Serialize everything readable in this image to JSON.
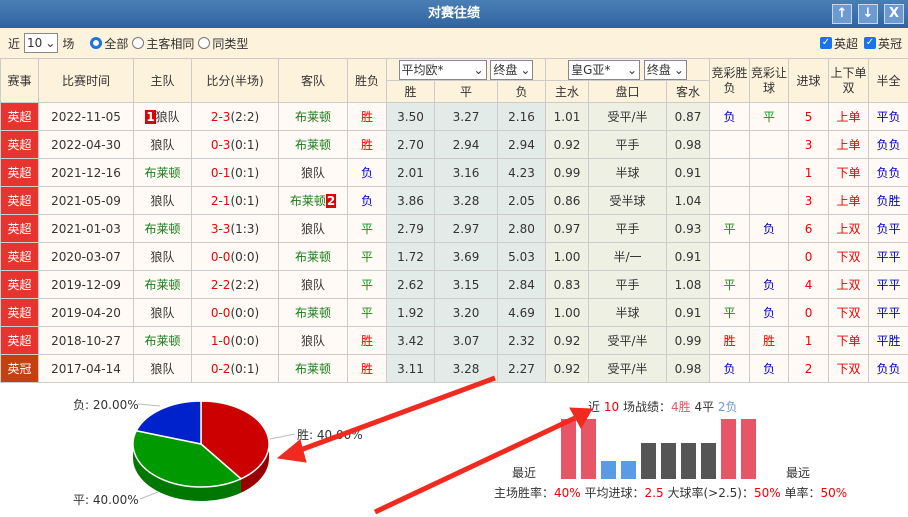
{
  "title": "对赛往绩",
  "title_buttons": [
    "↑",
    "↓",
    "X"
  ],
  "filter": {
    "prefix": "近",
    "count": "10",
    "suffix": "场",
    "radios": [
      "全部",
      "主客相同",
      "同类型"
    ],
    "selected_radio": "全部",
    "leagues": [
      "英超",
      "英冠"
    ]
  },
  "header": {
    "cols": [
      "赛事",
      "比赛时间",
      "主队",
      "比分(半场)",
      "客队",
      "胜负"
    ],
    "euro_select": "平均欧*",
    "euro_type": "终盘",
    "euro_cols": [
      "胜",
      "平",
      "负"
    ],
    "asia_select": "皇G亚*",
    "asia_type": "终盘",
    "asia_cols": [
      "主水",
      "盘口",
      "客水"
    ],
    "jc_result": "竞彩胜负",
    "jc_handicap": "竞彩让球",
    "goals": "进球",
    "ou": "上下单双",
    "htft": "半全"
  },
  "rows": [
    {
      "league": "英超",
      "date": "2022-11-05",
      "home": "狼队",
      "home_rank": "1",
      "score": "2-3",
      "half": "(2:2)",
      "away": "布莱顿",
      "away_rank": "",
      "res": "胜",
      "e": [
        "3.50",
        "3.27",
        "2.16"
      ],
      "a": [
        "1.01",
        "受平/半",
        "0.87"
      ],
      "jc": "负",
      "jr": "平",
      "goals": "5",
      "ou": "上单",
      "hf": "平负"
    },
    {
      "league": "英超",
      "date": "2022-04-30",
      "home": "狼队",
      "home_rank": "",
      "score": "0-3",
      "half": "(0:1)",
      "away": "布莱顿",
      "away_rank": "",
      "res": "胜",
      "e": [
        "2.70",
        "2.94",
        "2.94"
      ],
      "a": [
        "0.92",
        "平手",
        "0.98"
      ],
      "jc": "",
      "jr": "",
      "goals": "3",
      "ou": "上单",
      "hf": "负负"
    },
    {
      "league": "英超",
      "date": "2021-12-16",
      "home": "布莱顿",
      "home_rank": "",
      "score": "0-1",
      "half": "(0:1)",
      "away": "狼队",
      "away_rank": "",
      "res": "负",
      "e": [
        "2.01",
        "3.16",
        "4.23"
      ],
      "a": [
        "0.99",
        "半球",
        "0.91"
      ],
      "jc": "",
      "jr": "",
      "goals": "1",
      "ou": "下单",
      "hf": "负负"
    },
    {
      "league": "英超",
      "date": "2021-05-09",
      "home": "狼队",
      "home_rank": "",
      "score": "2-1",
      "half": "(0:1)",
      "away": "布莱顿",
      "away_rank": "2",
      "res": "负",
      "e": [
        "3.86",
        "3.28",
        "2.05"
      ],
      "a": [
        "0.86",
        "受半球",
        "1.04"
      ],
      "jc": "",
      "jr": "",
      "goals": "3",
      "ou": "上单",
      "hf": "负胜"
    },
    {
      "league": "英超",
      "date": "2021-01-03",
      "home": "布莱顿",
      "home_rank": "",
      "score": "3-3",
      "half": "(1:3)",
      "away": "狼队",
      "away_rank": "",
      "res": "平",
      "e": [
        "2.79",
        "2.97",
        "2.80"
      ],
      "a": [
        "0.97",
        "平手",
        "0.93"
      ],
      "jc": "平",
      "jr": "负",
      "goals": "6",
      "ou": "上双",
      "hf": "负平"
    },
    {
      "league": "英超",
      "date": "2020-03-07",
      "home": "狼队",
      "home_rank": "",
      "score": "0-0",
      "half": "(0:0)",
      "away": "布莱顿",
      "away_rank": "",
      "res": "平",
      "e": [
        "1.72",
        "3.69",
        "5.03"
      ],
      "a": [
        "1.00",
        "半/一",
        "0.91"
      ],
      "jc": "",
      "jr": "",
      "goals": "0",
      "ou": "下双",
      "hf": "平平"
    },
    {
      "league": "英超",
      "date": "2019-12-09",
      "home": "布莱顿",
      "home_rank": "",
      "score": "2-2",
      "half": "(2:2)",
      "away": "狼队",
      "away_rank": "",
      "res": "平",
      "e": [
        "2.62",
        "3.15",
        "2.84"
      ],
      "a": [
        "0.83",
        "平手",
        "1.08"
      ],
      "jc": "平",
      "jr": "负",
      "goals": "4",
      "ou": "上双",
      "hf": "平平"
    },
    {
      "league": "英超",
      "date": "2019-04-20",
      "home": "狼队",
      "home_rank": "",
      "score": "0-0",
      "half": "(0:0)",
      "away": "布莱顿",
      "away_rank": "",
      "res": "平",
      "e": [
        "1.92",
        "3.20",
        "4.69"
      ],
      "a": [
        "1.00",
        "半球",
        "0.91"
      ],
      "jc": "平",
      "jr": "负",
      "goals": "0",
      "ou": "下双",
      "hf": "平平"
    },
    {
      "league": "英超",
      "date": "2018-10-27",
      "home": "布莱顿",
      "home_rank": "",
      "score": "1-0",
      "half": "(0:0)",
      "away": "狼队",
      "away_rank": "",
      "res": "胜",
      "e": [
        "3.42",
        "3.07",
        "2.32"
      ],
      "a": [
        "0.92",
        "受平/半",
        "0.99"
      ],
      "jc": "胜",
      "jr": "胜",
      "goals": "1",
      "ou": "下单",
      "hf": "平胜"
    },
    {
      "league": "英冠",
      "date": "2017-04-14",
      "home": "狼队",
      "home_rank": "",
      "score": "0-2",
      "half": "(0:1)",
      "away": "布莱顿",
      "away_rank": "",
      "res": "胜",
      "e": [
        "3.11",
        "3.28",
        "2.27"
      ],
      "a": [
        "0.92",
        "受平/半",
        "0.98"
      ],
      "jc": "负",
      "jr": "负",
      "goals": "2",
      "ou": "下双",
      "hf": "负负"
    }
  ],
  "pie": {
    "slices": [
      {
        "label": "胜: 40.00%",
        "value": 40,
        "color": "#cc0000",
        "side": "#990000"
      },
      {
        "label": "平: 40.00%",
        "value": 40,
        "color": "#009900",
        "side": "#007700"
      },
      {
        "label": "负: 20.00%",
        "value": 20,
        "color": "#0022cc",
        "side": "#001a99"
      }
    ]
  },
  "summary": {
    "prefix": "近",
    "count": "10",
    "mid": "场战绩：",
    "wins": "4胜",
    "draws": "4平",
    "losses": "2负",
    "recent": "最近",
    "far": "最远",
    "results": [
      "W",
      "W",
      "L",
      "L",
      "D",
      "D",
      "D",
      "D",
      "W",
      "W"
    ],
    "colors": {
      "W": "#e85566",
      "L": "#5b9be6",
      "D": "#555555"
    },
    "stats": [
      {
        "label": "主场胜率：",
        "value": "40%"
      },
      {
        "label": "平均进球：",
        "value": "2.5"
      },
      {
        "label": "大球率(>2.5)：",
        "value": "50%"
      },
      {
        "label": "单率：",
        "value": "50%"
      }
    ]
  }
}
